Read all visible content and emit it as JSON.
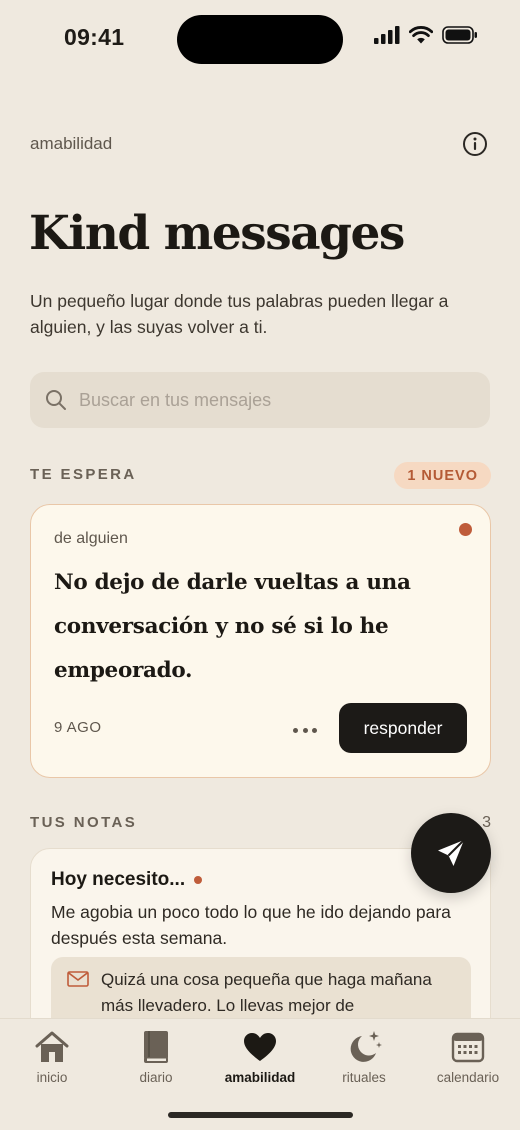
{
  "status_bar": {
    "time": "09:41"
  },
  "header": {
    "breadcrumb": "amabilidad",
    "title": "Kind messages",
    "subtitle": "Un pequeño lugar donde tus palabras pueden llegar a alguien, y las suyas volver a ti."
  },
  "search": {
    "placeholder": "Buscar en tus mensajes",
    "value": ""
  },
  "waiting": {
    "label": "TE ESPERA",
    "badge": "1 NUEVO",
    "message": {
      "from": "de alguien",
      "text": "No dejo de darle vueltas a una conversación y no sé si lo he empeorado.",
      "date": "9 AGO",
      "reply_label": "responder"
    }
  },
  "notes": {
    "label": "TUS NOTAS",
    "count": "3",
    "items": [
      {
        "title": "Hoy necesito...",
        "body": "Me agobia un poco todo lo que he ido dejando para después esta semana.",
        "reply": "Quizá una cosa pequeña que haga mañana más llevadero. Lo llevas mejor de"
      }
    ]
  },
  "tabs": [
    {
      "label": "inicio",
      "icon": "home-icon"
    },
    {
      "label": "diario",
      "icon": "book-icon"
    },
    {
      "label": "amabilidad",
      "icon": "heart-icon",
      "active": true
    },
    {
      "label": "rituales",
      "icon": "moon-stars-icon"
    },
    {
      "label": "calendario",
      "icon": "calendar-icon"
    }
  ],
  "colors": {
    "background": "#efe9df",
    "accent": "#bf5c3a",
    "dark": "#1c1a17",
    "badge_bg": "#f6d9c2"
  }
}
